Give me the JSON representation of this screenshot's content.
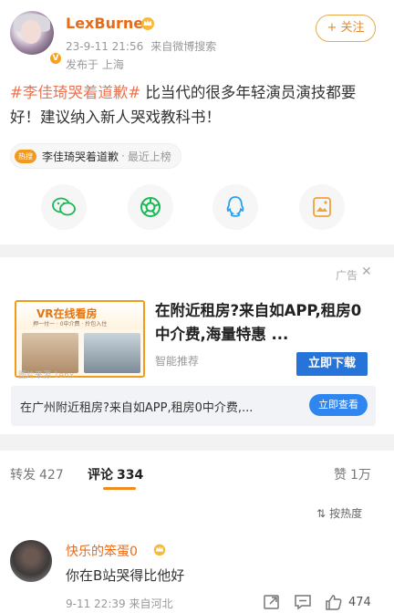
{
  "post": {
    "username": "LexBurner",
    "timestamp": "23-9-11 21:56",
    "source": "来自微博搜索",
    "location": "发布于 上海",
    "follow_label": "+ 关注",
    "topic": "#李佳琦哭着道歉#",
    "text": " 比当代的很多年轻演员演技都要好！建议纳入新人哭戏教科书！",
    "chip": {
      "badge": "热搜",
      "title": "李佳琦哭着道歉",
      "separator": "·",
      "rank": "最近上榜"
    },
    "share_icons": [
      "wechat-icon",
      "moments-icon",
      "qq-icon",
      "save-icon"
    ]
  },
  "ad": {
    "label": "广告",
    "close": "✕",
    "image_title": "VR在线看房",
    "image_subtitle": "押一付一 · 0中介费 · 拎包入住",
    "image_caption": "图片来源 1enx",
    "title": "在附近租房?来自如APP,租房0中介费,海量特惠 ...",
    "source": "智能推荐",
    "download_label": "立即下载",
    "banner_text": "在广州附近租房?来自如APP,租房0中介费,...",
    "banner_button": "立即查看",
    "accent": "#2673d9"
  },
  "tabs": [
    {
      "label": "转发",
      "count": "427"
    },
    {
      "label": "评论",
      "count": "334"
    },
    {
      "label": "赞",
      "count": "1万"
    }
  ],
  "comments": {
    "sort_label": "按热度",
    "items": [
      {
        "user": "快乐的笨蛋0",
        "text": "你在B站哭得比他好",
        "meta": "9-11 22:39 来自河北",
        "likes": "474"
      }
    ]
  },
  "colors": {
    "username": "#e86b16",
    "topic": "#eb7350",
    "tab_underline": "#f08a1c"
  }
}
